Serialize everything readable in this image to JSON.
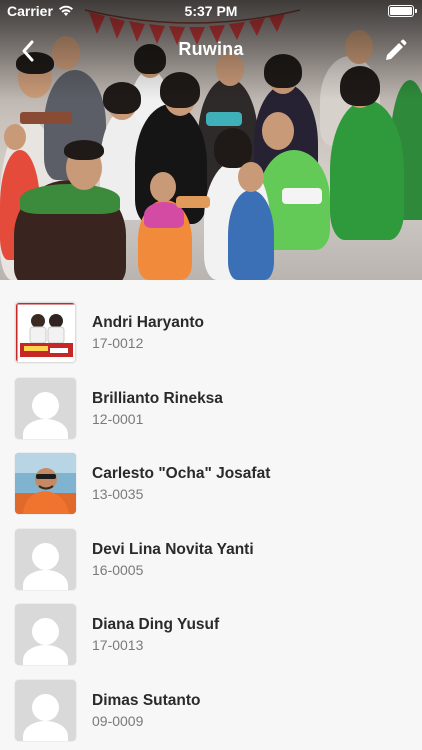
{
  "status_bar": {
    "carrier": "Carrier",
    "time": "5:37 PM"
  },
  "nav": {
    "title": "Ruwina",
    "back_icon": "chevron-left-icon",
    "edit_icon": "pencil-icon"
  },
  "members": [
    {
      "name": "Andri Haryanto",
      "code": "17-0012",
      "avatar": "campaign-photo"
    },
    {
      "name": "Brillianto Rineksa",
      "code": "12-0001",
      "avatar": "placeholder"
    },
    {
      "name": "Carlesto \"Ocha\" Josafat",
      "code": "13-0035",
      "avatar": "photo"
    },
    {
      "name": "Devi Lina Novita Yanti",
      "code": "16-0005",
      "avatar": "placeholder"
    },
    {
      "name": "Diana Ding Yusuf",
      "code": "17-0013",
      "avatar": "placeholder"
    },
    {
      "name": "Dimas Sutanto",
      "code": "09-0009",
      "avatar": "placeholder"
    }
  ],
  "colors": {
    "list_bg": "#f7f7f7",
    "name": "#2a2a2a",
    "code": "#7a7a7a"
  }
}
